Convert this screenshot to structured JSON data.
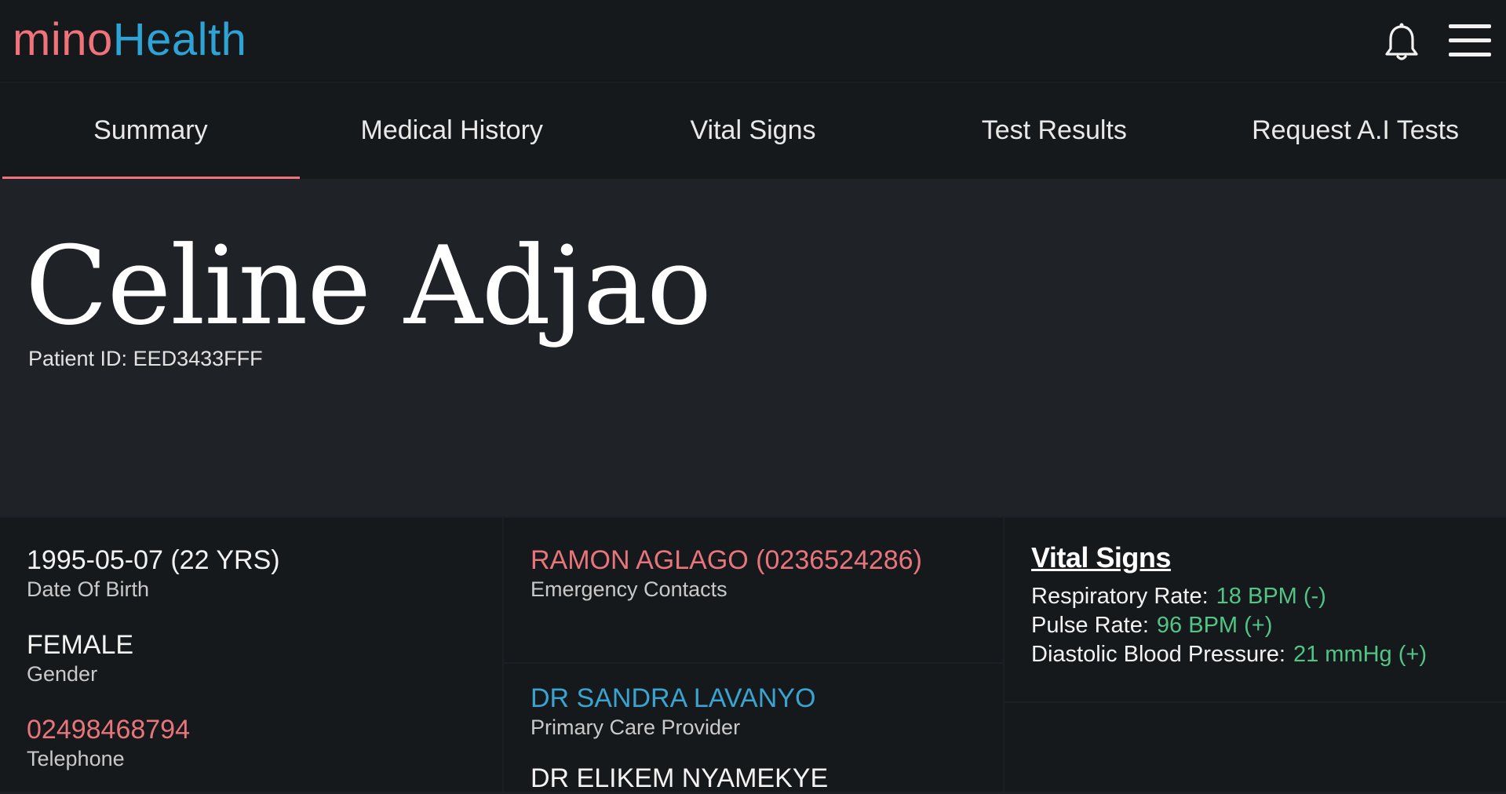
{
  "app": {
    "logo_part1": "mino",
    "logo_part2": "Health",
    "colors": {
      "logo_pink": "#f0727a",
      "logo_blue": "#2ea3d5",
      "accent_underline": "#f0727a",
      "value_green": "#52c486"
    },
    "icons": [
      "bell-icon",
      "hamburger-menu-icon"
    ]
  },
  "tabs": [
    {
      "label": "Summary",
      "active": true
    },
    {
      "label": "Medical History",
      "active": false
    },
    {
      "label": "Vital Signs",
      "active": false
    },
    {
      "label": "Test Results",
      "active": false
    },
    {
      "label": "Request A.I Tests",
      "active": false
    }
  ],
  "patient": {
    "name": "Celine Adjao",
    "id_text": "Patient ID: EED3433FFF"
  },
  "details": {
    "dob_value": "1995-05-07 (22 YRS)",
    "dob_label": "Date Of Birth",
    "gender_value": "FEMALE",
    "gender_label": "Gender",
    "phone_value": "02498468794",
    "phone_label": "Telephone"
  },
  "contacts": {
    "emergency_value": "RAMON AGLAGO (0236524286)",
    "emergency_label": "Emergency Contacts",
    "provider_value": "DR SANDRA LAVANYO",
    "provider_label": "Primary Care Provider",
    "provider2_value": "DR ELIKEM NYAMEKYE"
  },
  "vital_signs": {
    "title": "Vital Signs",
    "rows": [
      {
        "label": "Respiratory Rate:",
        "value": "18 BPM (-)"
      },
      {
        "label": "Pulse Rate:",
        "value": "96 BPM (+)"
      },
      {
        "label": "Diastolic Blood Pressure:",
        "value": "21 mmHg (+)"
      }
    ]
  }
}
